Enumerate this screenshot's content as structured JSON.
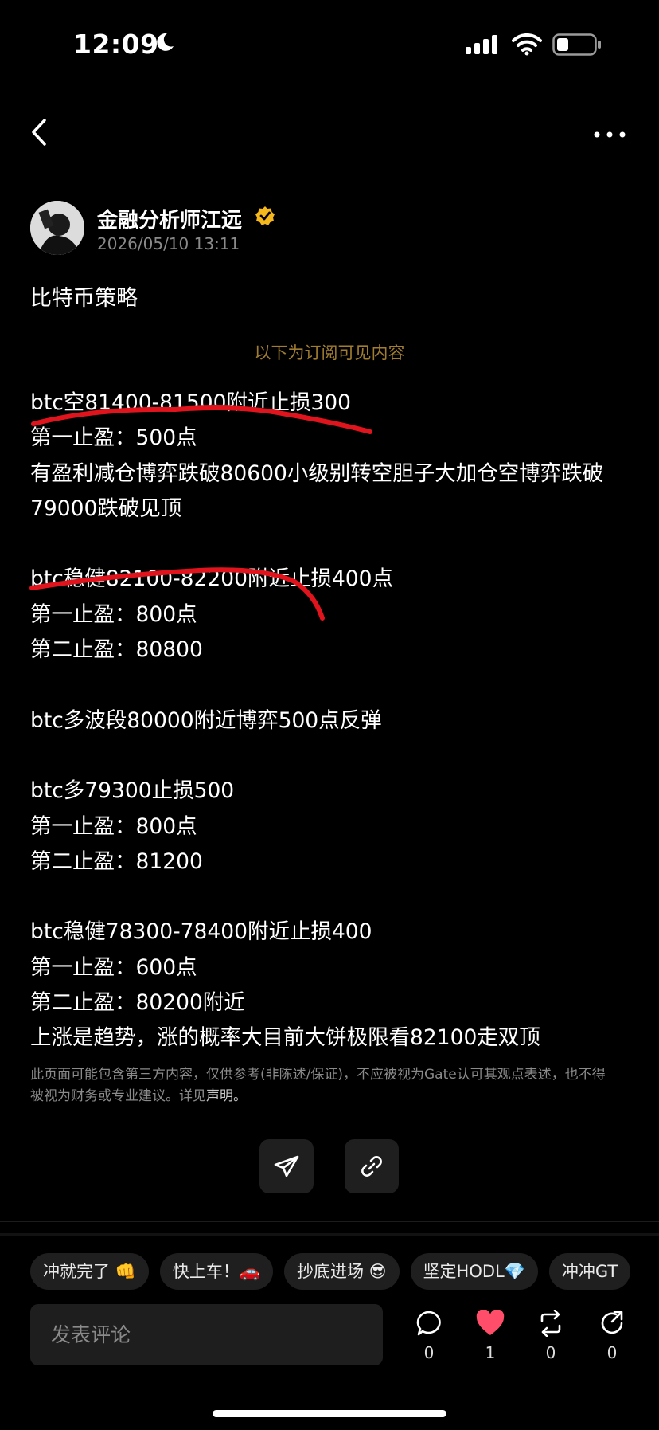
{
  "status_bar": {
    "time": "12:09"
  },
  "author": {
    "name": "金融分析师江远",
    "time": "2026/05/10 13:11"
  },
  "post": {
    "title": "比特币策略",
    "subscriber_label": "以下为订阅可见内容",
    "lines": [
      "btc空81400-81500附近止损300",
      "第一止盈：500点",
      "有盈利减仓博弈跌破80600小级别转空胆子大加仓空博弈跌破79000跌破见顶",
      "",
      "btc稳健82100-82200附近止损400点",
      "第一止盈：800点",
      "第二止盈：80800",
      "",
      "btc多波段80000附近博弈500点反弹",
      "",
      "btc多79300止损500",
      "第一止盈：800点",
      "第二止盈：81200",
      "",
      "btc稳健78300-78400附近止损400",
      "第一止盈：600点",
      "第二止盈：80200附近",
      "上涨是趋势，涨的概率大目前大饼极限看82100走双顶"
    ],
    "disclaimer": "此页面可能包含第三方内容，仅供参考(非陈述/保证)，不应被视为Gate认可其观点表述，也不得被视为财务或专业建议。详见",
    "disclaimer_link": "声明。"
  },
  "chips": [
    "冲就完了 👊",
    "快上车！🚗",
    "抄底进场 😎",
    "坚定HODL💎",
    "冲冲GT"
  ],
  "comment_bar": {
    "placeholder": "发表评论",
    "comment_count": "0",
    "like_count": "1",
    "repost_count": "0",
    "share_count": "0"
  },
  "colors": {
    "accent_gold": "#a07d30",
    "like_red": "#ff4d6a",
    "verified": "#f5b81c",
    "scribble": "#e0141c"
  }
}
